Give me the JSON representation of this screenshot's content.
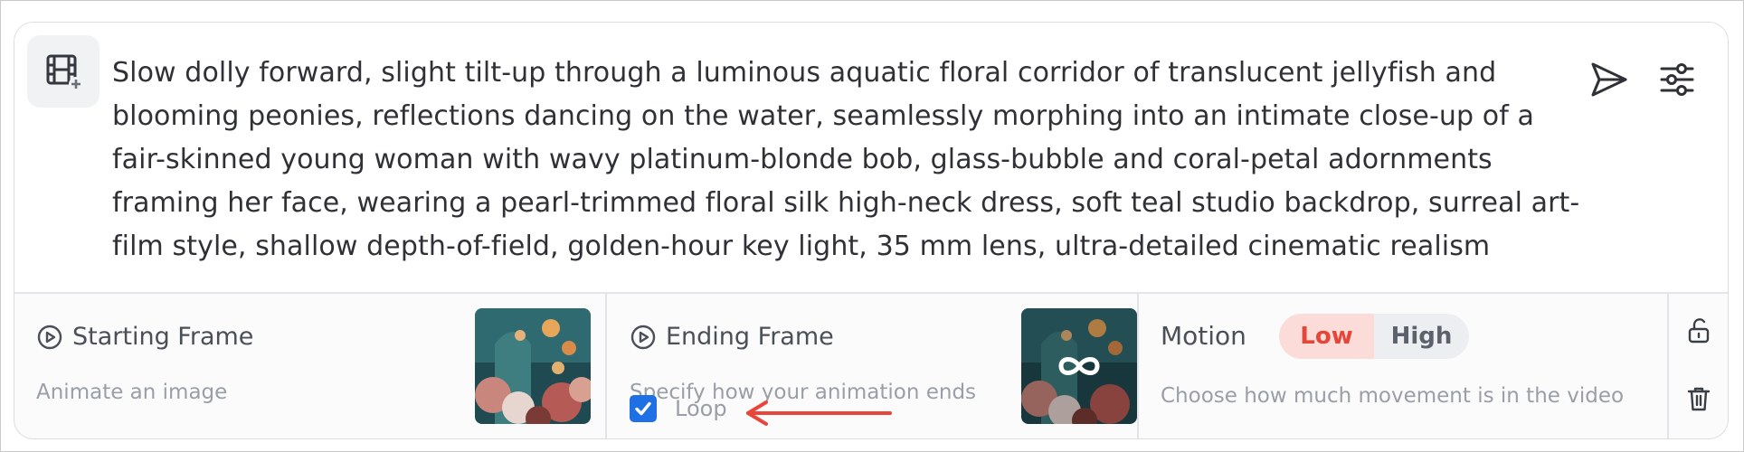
{
  "prompt": {
    "text": "Slow dolly forward, slight tilt-up through a luminous aquatic floral corridor of translucent jellyfish and blooming peonies, reflections dancing on the water, seamlessly morphing into an intimate close-up of a fair-skinned young woman with wavy platinum-blonde bob, glass-bubble and coral-petal adornments framing her face, wearing a pearl-trimmed floral silk high-neck dress, soft teal studio backdrop, surreal art-film style, shallow depth-of-field, golden-hour key light, 35 mm lens, ultra-detailed cinematic realism"
  },
  "icons": {
    "mode": "film-add-icon",
    "send": "send-icon",
    "settings": "sliders-icon",
    "play": "play-circle-icon",
    "loop": "infinity-icon",
    "lock": "unlock-icon",
    "delete": "trash-icon",
    "annotation": "arrow-left-icon"
  },
  "starting_frame": {
    "title": "Starting Frame",
    "subtitle": "Animate an image"
  },
  "ending_frame": {
    "title": "Ending Frame",
    "subtitle": "Specify how your animation ends",
    "loop_label": "Loop",
    "loop_checked": true
  },
  "motion": {
    "title": "Motion",
    "options": [
      "Low",
      "High"
    ],
    "selected": "Low",
    "subtitle": "Choose how much movement is in the video"
  },
  "colors": {
    "accent_blue": "#1f6fe5",
    "selected_bg": "#fbdcd8",
    "selected_text": "#e4473a",
    "annotation_arrow": "#e8463a"
  }
}
